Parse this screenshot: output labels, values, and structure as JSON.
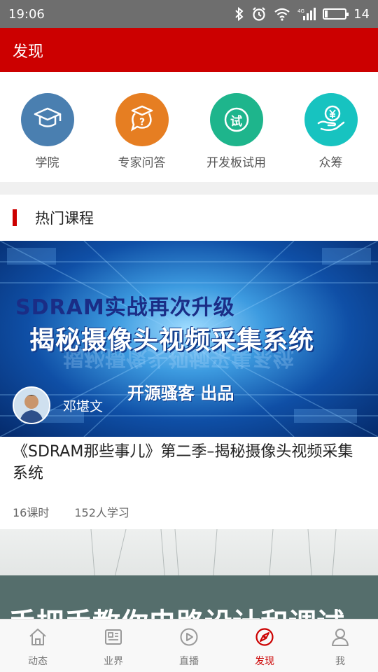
{
  "status_bar": {
    "time": "19:06",
    "battery": "14"
  },
  "app_bar": {
    "title": "发现"
  },
  "quick_entries": [
    {
      "label": "学院",
      "color": "#4a7fb0",
      "icon": "graduation-cap-icon"
    },
    {
      "label": "专家问答",
      "color": "#e67e22",
      "icon": "expert-question-icon"
    },
    {
      "label": "开发板试用",
      "color": "#1eb58c",
      "icon": "trial-icon"
    },
    {
      "label": "众筹",
      "color": "#17c3c0",
      "icon": "crowdfunding-icon"
    }
  ],
  "trial_glyph": "试",
  "section": {
    "title": "热门课程"
  },
  "course1": {
    "banner_line1": "SDRAM实战再次升级",
    "banner_line2": "揭秘摄像头视频采集系统",
    "banner_line3": "开源骚客 出品",
    "author": "邓堪文",
    "title": "《SDRAM那些事儿》第二季–揭秘摄像头视频采集系统",
    "lessons": "16课时",
    "learners": "152人学习"
  },
  "course2": {
    "banner_text": "手把手教你电路设计和调试"
  },
  "bottom_nav": [
    {
      "label": "动态",
      "icon": "home-icon",
      "active": false
    },
    {
      "label": "业界",
      "icon": "news-icon",
      "active": false
    },
    {
      "label": "直播",
      "icon": "play-icon",
      "active": false
    },
    {
      "label": "发现",
      "icon": "discover-icon",
      "active": true
    },
    {
      "label": "我",
      "icon": "profile-icon",
      "active": false
    }
  ],
  "colors": {
    "brand_red": "#cc0000"
  }
}
